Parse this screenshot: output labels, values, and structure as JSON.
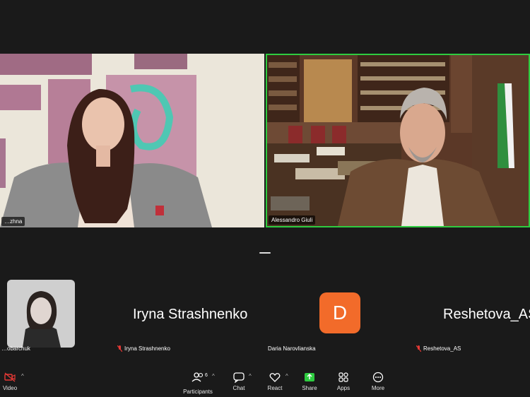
{
  "stage": {
    "left_tile": {
      "name": "…zhna"
    },
    "right_tile": {
      "name": "Alessandro Giuli"
    }
  },
  "strip": {
    "thumb1": {
      "label": "…obarchuk"
    },
    "thumb2": {
      "big_name": "Iryna Strashnenko",
      "label": "Iryna Strashnenko"
    },
    "thumb3": {
      "avatar_letter": "D",
      "label": "Daria Narovlianska"
    },
    "thumb4": {
      "big_name": "Reshetova_AS",
      "label": "Reshetova_AS"
    }
  },
  "toolbar": {
    "video_label": "Video",
    "participants_label": "Participants",
    "participants_count": "6",
    "chat_label": "Chat",
    "react_label": "React",
    "share_label": "Share",
    "apps_label": "Apps",
    "more_label": "More"
  },
  "colors": {
    "active_speaker_border": "#2ecc40",
    "avatar_bg": "#f26b2a",
    "share_accent": "#2ecc40",
    "muted_red": "#e53935"
  }
}
